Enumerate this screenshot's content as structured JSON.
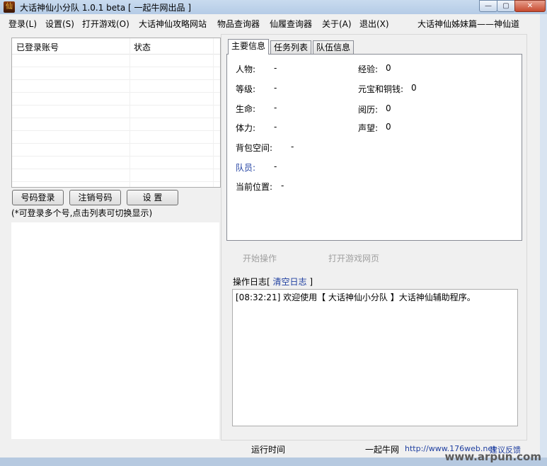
{
  "window": {
    "title": "大话神仙小分队 1.0.1 beta [ 一起牛网出品 ]",
    "buttons": {
      "minimize": "—",
      "maximize": "▢",
      "close": "✕"
    }
  },
  "menu": {
    "items": [
      "登录(L)",
      "设置(S)",
      "打开游戏(O)",
      "大话神仙攻略网站",
      "物品查询器",
      "仙履查询器",
      "关于(A)",
      "退出(X)"
    ],
    "right_text": "大话神仙姊妹篇——神仙道"
  },
  "accounts": {
    "col_account": "已登录账号",
    "col_status": "状态"
  },
  "buttons": {
    "login": "号码登录",
    "logout": "注销号码",
    "settings": "设 置",
    "start": "开始操作",
    "open_web": "打开游戏网页"
  },
  "hint": "(*可登录多个号,点击列表可切换显示)",
  "tabs": [
    "主要信息",
    "任务列表",
    "队伍信息"
  ],
  "info": {
    "character": {
      "label": "人物:",
      "value": "-"
    },
    "level": {
      "label": "等级:",
      "value": "-"
    },
    "life": {
      "label": "生命:",
      "value": "-"
    },
    "stamina": {
      "label": "体力:",
      "value": "-"
    },
    "bag": {
      "label": "背包空间:",
      "value": "-"
    },
    "member": {
      "label": "队员:",
      "value": "-"
    },
    "location": {
      "label": "当前位置:",
      "value": "-"
    },
    "exp": {
      "label": "经验:",
      "value": "0"
    },
    "money": {
      "label": "元宝和铜钱:",
      "value": "0"
    },
    "experience": {
      "label": "阅历:",
      "value": "0"
    },
    "reputation": {
      "label": "声望:",
      "value": "0"
    }
  },
  "log": {
    "title_prefix": "操作日志[",
    "clear_link": "清空日志",
    "title_suffix": "]",
    "lines": [
      "[08:32:21] 欢迎使用【 大话神仙小分队 】大话神仙辅助程序。"
    ]
  },
  "status": {
    "run_time": "运行时间",
    "brand": "一起牛网",
    "url": "http://www.176web.net",
    "feedback": "建议反馈"
  },
  "watermark": "www.arpun.com"
}
